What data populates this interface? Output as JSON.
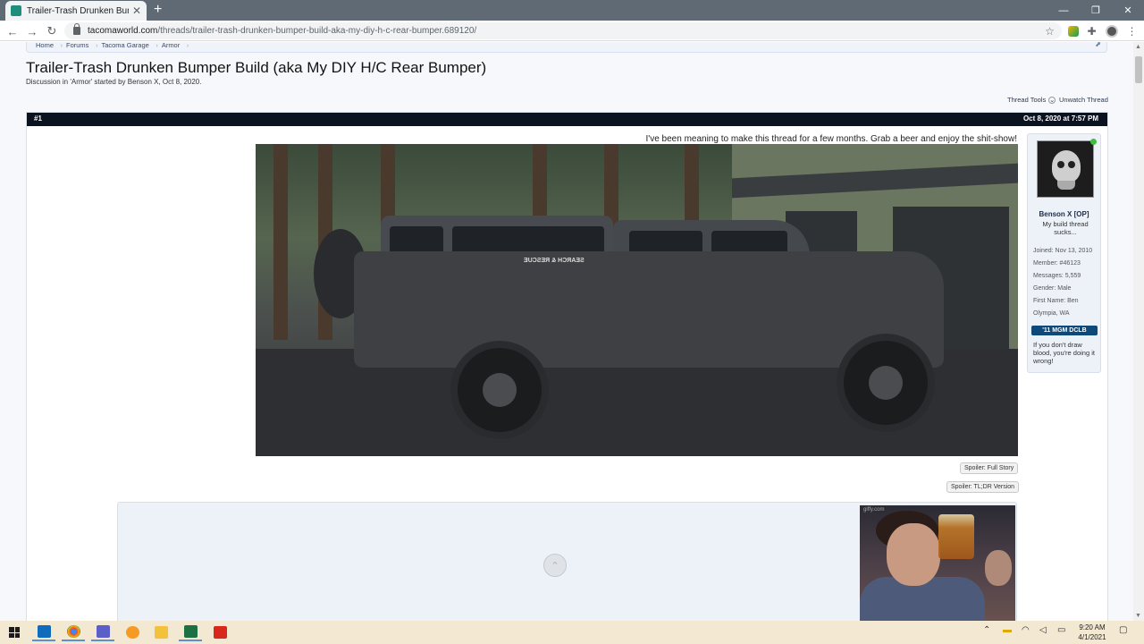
{
  "browser": {
    "tab_title": "Trailer-Trash Drunken Bumper B",
    "tab_close": "✕",
    "new_tab": "+",
    "window_buttons": [
      "—",
      "❐",
      "✕"
    ],
    "url_host": "tacomaworld.com",
    "url_path": "/threads/trailer-trash-drunken-bumper-build-aka-my-diy-h-c-rear-bumper.689120/"
  },
  "breadcrumb": [
    "Home",
    "Forums",
    "Tacoma Garage",
    "Armor"
  ],
  "thread": {
    "title": "Trailer-Trash Drunken Bumper Build (aka My DIY H/C Rear Bumper)",
    "meta": "Discussion in 'Armor' started by Benson X, Oct 8, 2020.",
    "tools_label": "Thread Tools",
    "unwatch_label": "Unwatch Thread"
  },
  "post": {
    "number": "#1",
    "date": "Oct 8, 2020 at 7:57 PM",
    "text": "I've been meaning to make this thread for a few months. Grab a beer and enjoy the shit-show!",
    "cap_sticker": "SEARCH & RESCUE",
    "spoiler_full": "Spoiler: Full Story",
    "spoiler_tldr": "Spoiler: TL;DR Version",
    "embed_credit": "giffy.com"
  },
  "user": {
    "name": "Benson X [OP]",
    "title": "My build thread sucks...",
    "stats": [
      "Joined: Nov 13, 2010",
      "Member: #46123",
      "Messages: 5,559",
      "Gender: Male",
      "First Name: Ben",
      "Olympia, WA"
    ],
    "badge": "'11 MGM DCLB",
    "signature": "If you don't draw blood, you're doing it wrong!"
  },
  "taskbar": {
    "clock_time": "9:20 AM",
    "clock_date": "4/1/2021"
  },
  "colors": {
    "post_header": "#0b1220",
    "userbox_bg": "#edf2f9",
    "taskbar_bg": "#f3e9d2"
  }
}
